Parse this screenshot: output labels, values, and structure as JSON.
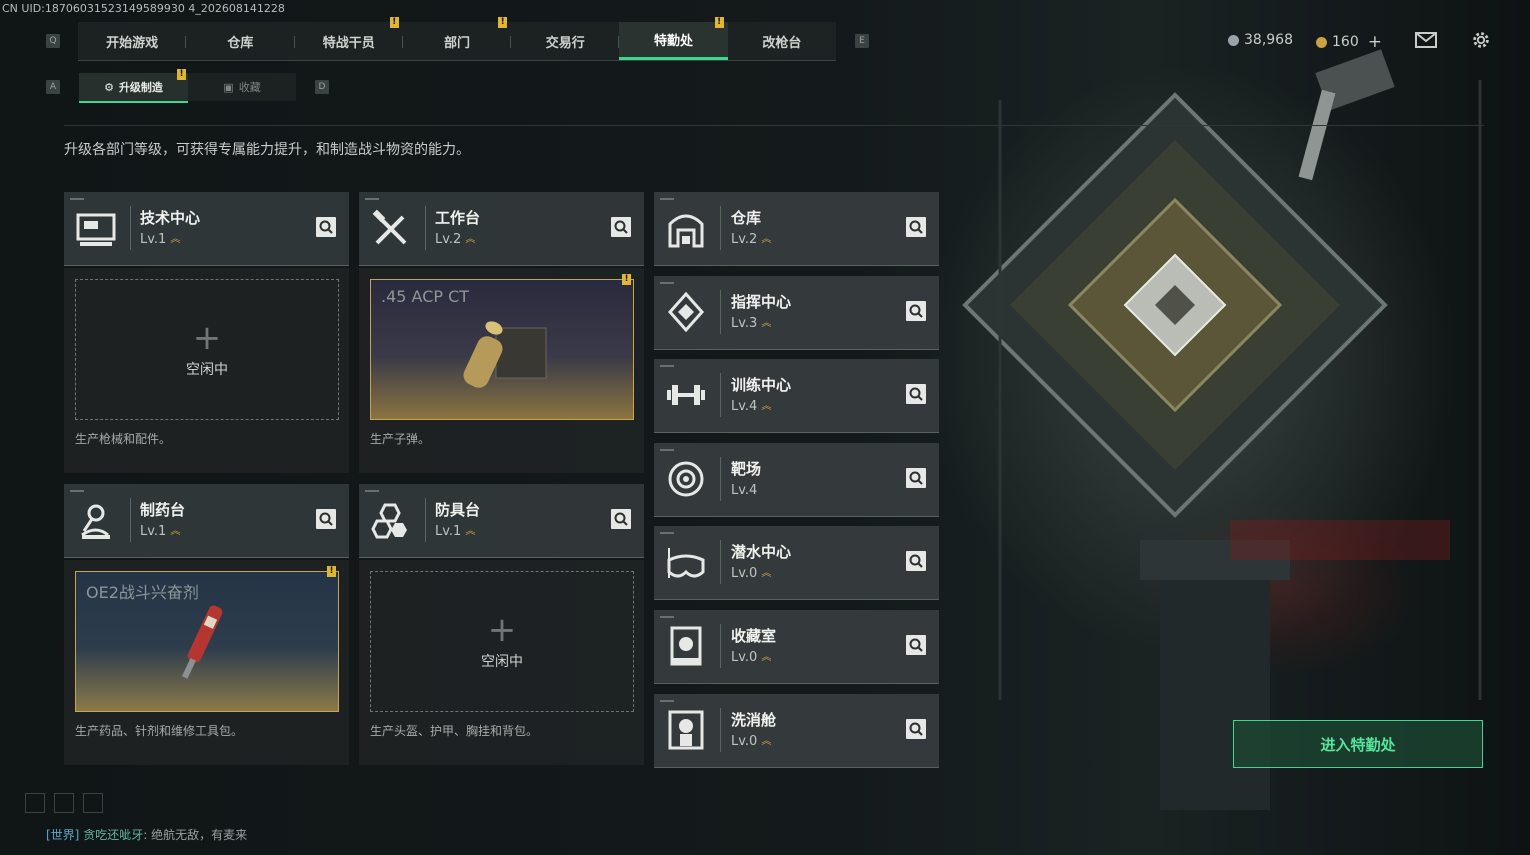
{
  "uid": "CN UID:18706031523149589930 4_202608141228",
  "nav": {
    "left_key": "Q",
    "right_key": "E",
    "tabs": [
      {
        "label": "开始游戏",
        "active": false,
        "alert": false
      },
      {
        "label": "仓库",
        "active": false,
        "alert": false
      },
      {
        "label": "特战干员",
        "active": false,
        "alert": true
      },
      {
        "label": "部门",
        "active": false,
        "alert": true
      },
      {
        "label": "交易行",
        "active": false,
        "alert": false
      },
      {
        "label": "特勤处",
        "active": true,
        "alert": true
      },
      {
        "label": "改枪台",
        "active": false,
        "alert": false
      }
    ]
  },
  "currency": {
    "silver": "38,968",
    "gold": "160",
    "plus": "+"
  },
  "subnav": {
    "left_key": "A",
    "right_key": "D",
    "tabs": [
      {
        "label": "升级制造",
        "active": true
      },
      {
        "label": "收藏",
        "active": false
      }
    ]
  },
  "description": "升级各部门等级，可获得专属能力提升，和制造战斗物资的能力。",
  "alert_mark": "!",
  "production": [
    {
      "name": "技术中心",
      "level": "Lv.1",
      "icon": "computer-icon",
      "slot": {
        "state": "empty",
        "label": "空闲中"
      },
      "desc": "生产枪械和配件。"
    },
    {
      "name": "工作台",
      "level": "Lv.2",
      "icon": "tools-icon",
      "slot": {
        "state": "item",
        "item": ".45 ACP CT"
      },
      "desc": "生产子弹。"
    },
    {
      "name": "制药台",
      "level": "Lv.1",
      "icon": "microscope-icon",
      "slot": {
        "state": "item",
        "item": "OE2战斗兴奋剂"
      },
      "desc": "生产药品、针剂和维修工具包。"
    },
    {
      "name": "防具台",
      "level": "Lv.1",
      "icon": "armor-icon",
      "slot": {
        "state": "empty",
        "label": "空闲中"
      },
      "desc": "生产头盔、护甲、胸挂和背包。"
    }
  ],
  "departments": [
    {
      "name": "仓库",
      "level": "Lv.2",
      "icon": "warehouse-icon",
      "upgrade": true
    },
    {
      "name": "指挥中心",
      "level": "Lv.3",
      "icon": "command-icon",
      "upgrade": true
    },
    {
      "name": "训练中心",
      "level": "Lv.4",
      "icon": "dumbbell-icon",
      "upgrade": true
    },
    {
      "name": "靶场",
      "level": "Lv.4",
      "icon": "target-icon",
      "upgrade": false
    },
    {
      "name": "潜水中心",
      "level": "Lv.0",
      "icon": "diving-mask-icon",
      "upgrade": true
    },
    {
      "name": "收藏室",
      "level": "Lv.0",
      "icon": "collection-icon",
      "upgrade": true
    },
    {
      "name": "洗消舱",
      "level": "Lv.0",
      "icon": "decontamination-icon",
      "upgrade": true
    }
  ],
  "enter_button": "进入特勤处",
  "chat": {
    "channel": "[世界]",
    "name": "贪吃还呲牙",
    "message": "绝航无敌，有麦来"
  }
}
